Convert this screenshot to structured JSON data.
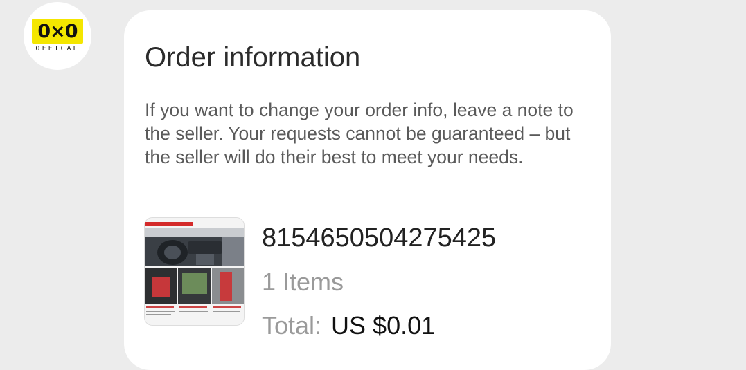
{
  "store": {
    "logo_text": "OFFICAL"
  },
  "order_info": {
    "title": "Order information",
    "note": "If you want to change your order info, leave a note to the seller. Your requests cannot be guaranteed – but the seller will do their best to meet your needs.",
    "order_number": "8154650504275425",
    "items_count": "1 Items",
    "total_label": "Total:",
    "total_value": "US $0.01"
  }
}
